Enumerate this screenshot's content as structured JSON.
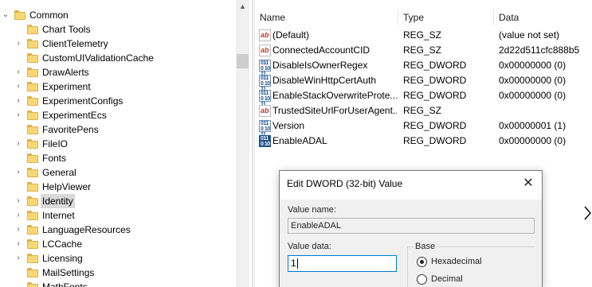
{
  "tree": {
    "items": [
      {
        "label": "Common",
        "expander": "v",
        "level": 0,
        "selected": false
      },
      {
        "label": "Chart Tools",
        "expander": "",
        "level": 1,
        "selected": false
      },
      {
        "label": "ClientTelemetry",
        "expander": ">",
        "level": 1,
        "selected": false
      },
      {
        "label": "CustomUIValidationCache",
        "expander": "",
        "level": 1,
        "selected": false
      },
      {
        "label": "DrawAlerts",
        "expander": ">",
        "level": 1,
        "selected": false
      },
      {
        "label": "Experiment",
        "expander": ">",
        "level": 1,
        "selected": false
      },
      {
        "label": "ExperimentConfigs",
        "expander": ">",
        "level": 1,
        "selected": false
      },
      {
        "label": "ExperimentEcs",
        "expander": ">",
        "level": 1,
        "selected": false
      },
      {
        "label": "FavoritePens",
        "expander": "",
        "level": 1,
        "selected": false
      },
      {
        "label": "FileIO",
        "expander": ">",
        "level": 1,
        "selected": false
      },
      {
        "label": "Fonts",
        "expander": "",
        "level": 1,
        "selected": false
      },
      {
        "label": "General",
        "expander": ">",
        "level": 1,
        "selected": false
      },
      {
        "label": "HelpViewer",
        "expander": "",
        "level": 1,
        "selected": false
      },
      {
        "label": "Identity",
        "expander": ">",
        "level": 1,
        "selected": true
      },
      {
        "label": "Internet",
        "expander": ">",
        "level": 1,
        "selected": false
      },
      {
        "label": "LanguageResources",
        "expander": ">",
        "level": 1,
        "selected": false
      },
      {
        "label": "LCCache",
        "expander": ">",
        "level": 1,
        "selected": false
      },
      {
        "label": "Licensing",
        "expander": ">",
        "level": 1,
        "selected": false
      },
      {
        "label": "MailSettings",
        "expander": "",
        "level": 1,
        "selected": false
      },
      {
        "label": "MathFonts",
        "expander": "",
        "level": 1,
        "selected": false
      }
    ]
  },
  "list": {
    "columns": {
      "name": "Name",
      "type": "Type",
      "data": "Data"
    },
    "rows": [
      {
        "name": "(Default)",
        "type": "REG_SZ",
        "data": "(value not set)",
        "icon": "string-value-icon"
      },
      {
        "name": "ConnectedAccountCID",
        "type": "REG_SZ",
        "data": "2d22d511cfc888b5",
        "icon": "string-value-icon"
      },
      {
        "name": "DisableIsOwnerRegex",
        "type": "REG_DWORD",
        "data": "0x00000000 (0)",
        "icon": "dword-value-icon"
      },
      {
        "name": "DisableWinHttpCertAuth",
        "type": "REG_DWORD",
        "data": "0x00000000 (0)",
        "icon": "dword-value-icon"
      },
      {
        "name": "EnableStackOverwriteProte...",
        "type": "REG_DWORD",
        "data": "0x00000000 (0)",
        "icon": "dword-value-icon"
      },
      {
        "name": "TrustedSiteUrlForUserAgent...",
        "type": "REG_SZ",
        "data": "",
        "icon": "string-value-icon"
      },
      {
        "name": "Version",
        "type": "REG_DWORD",
        "data": "0x00000001 (1)",
        "icon": "dword-value-icon"
      },
      {
        "name": "EnableADAL",
        "type": "REG_DWORD",
        "data": "0x00000000 (0)",
        "icon": "dword-value-icon"
      }
    ]
  },
  "icons": {
    "string": "ab",
    "dword": "0110 1011"
  },
  "dialog": {
    "title": "Edit DWORD (32-bit) Value",
    "close_glyph": "✕",
    "value_name_label": "Value name:",
    "value_name": "EnableADAL",
    "value_data_label": "Value data:",
    "value_data": "1",
    "base_label": "Base",
    "hex_label": "Hexadecimal",
    "dec_label": "Decimal",
    "selected_base": "Hexadecimal"
  },
  "glyphs": {
    "expanded": "⌄",
    "collapsed": "›",
    "scroll_up": "▲"
  },
  "colors": {
    "folder": "#f8d775",
    "selection": "#d9d9d9",
    "focus": "#0078d7"
  }
}
